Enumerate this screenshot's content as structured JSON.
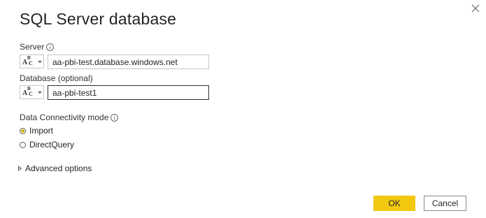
{
  "dialog": {
    "title": "SQL Server database",
    "close_icon": "close-icon"
  },
  "server": {
    "label": "Server",
    "info_icon": "info-icon",
    "type_icon": "abc-text-type-icon",
    "value": "aa-pbi-test.database.windows.net"
  },
  "database": {
    "label": "Database (optional)",
    "type_icon": "abc-text-type-icon",
    "value": "aa-pbi-test1"
  },
  "connectivity": {
    "label": "Data Connectivity mode",
    "info_icon": "info-icon",
    "options": [
      {
        "label": "Import",
        "selected": true
      },
      {
        "label": "DirectQuery",
        "selected": false
      }
    ]
  },
  "advanced": {
    "label": "Advanced options",
    "icon": "expand-arrow-icon"
  },
  "buttons": {
    "ok_label": "OK",
    "cancel_label": "Cancel"
  },
  "colors": {
    "accent": "#f2c811",
    "radio_dot": "#d9b300",
    "text": "#252423",
    "border": "#c8c6c4"
  }
}
